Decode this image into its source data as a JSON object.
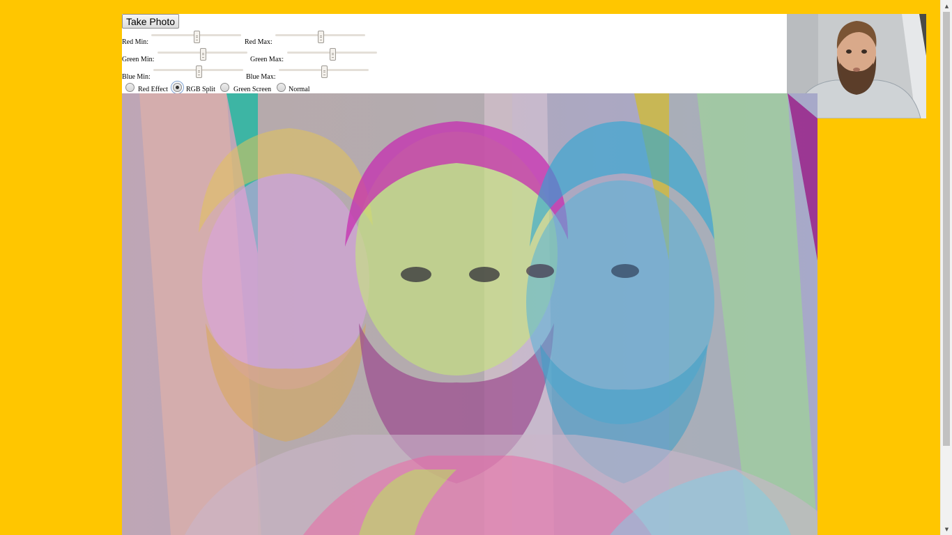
{
  "toolbar": {
    "take_photo_label": "Take Photo"
  },
  "sliders": {
    "red_min": {
      "label": "Red Min:",
      "value": 0.5
    },
    "red_max": {
      "label": "Red Max:",
      "value": 0.5
    },
    "green_min": {
      "label": "Green Min:",
      "value": 0.5
    },
    "green_max": {
      "label": "Green Max:",
      "value": 0.5
    },
    "blue_min": {
      "label": "Blue Min:",
      "value": 0.5
    },
    "blue_max": {
      "label": "Blue Max:",
      "value": 0.5
    }
  },
  "effects": {
    "options": [
      "Red Effect",
      "RGB Split",
      "Green Screen",
      "Normal"
    ],
    "selected": "RGB Split"
  },
  "colors": {
    "page_background": "#ffc600",
    "panel_background": "#ffffff"
  }
}
